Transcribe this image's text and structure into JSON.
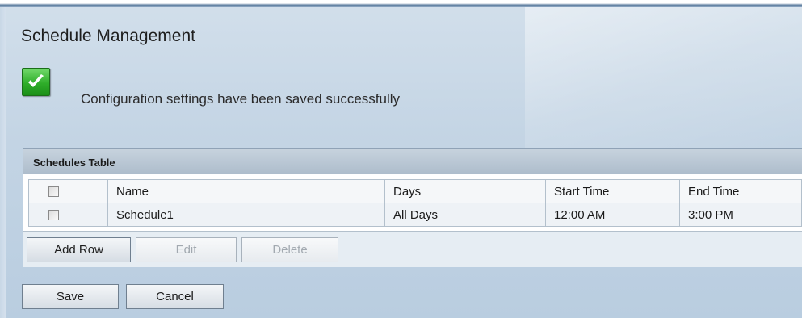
{
  "page": {
    "title": "Schedule Management"
  },
  "status": {
    "message": "Configuration settings have been saved successfully",
    "icon": "checkmark-icon",
    "color": "#2fae2a"
  },
  "schedules_table": {
    "title": "Schedules Table",
    "columns": [
      "Name",
      "Days",
      "Start Time",
      "End Time"
    ],
    "rows": [
      {
        "name": "Schedule1",
        "days": "All Days",
        "start": "12:00 AM",
        "end": "3:00 PM",
        "checked": false
      }
    ],
    "actions": {
      "add": "Add Row",
      "edit": "Edit",
      "delete": "Delete"
    }
  },
  "footer": {
    "save": "Save",
    "cancel": "Cancel"
  },
  "colors": {
    "accent": "#4f6f91",
    "panel_header": "#b7c5d3",
    "background": "#c3d4e4"
  }
}
